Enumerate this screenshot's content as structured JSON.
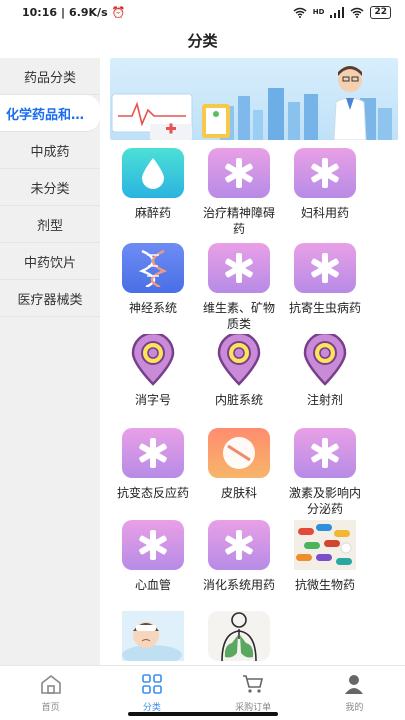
{
  "status": {
    "time": "10:16",
    "speed": "6.9K/s",
    "battery": "22",
    "network": "HD"
  },
  "header": {
    "title": "分类"
  },
  "sidebar": {
    "items": [
      {
        "label": "药品分类"
      },
      {
        "label": "化学药品和…",
        "active": true
      },
      {
        "label": "中成药"
      },
      {
        "label": "未分类"
      },
      {
        "label": "剂型"
      },
      {
        "label": "中药饮片"
      },
      {
        "label": "医疗器械类"
      }
    ]
  },
  "categories": [
    {
      "label": "麻醉药",
      "icon": "drop-icon",
      "style": "cyan"
    },
    {
      "label": "治疗精神障碍药",
      "icon": "asterisk-icon",
      "style": "pink"
    },
    {
      "label": "妇科用药",
      "icon": "asterisk-icon",
      "style": "pink"
    },
    {
      "label": "神经系统",
      "icon": "dna-icon",
      "style": "blue"
    },
    {
      "label": "维生素、矿物质类",
      "icon": "asterisk-icon",
      "style": "pink"
    },
    {
      "label": "抗寄生虫病药",
      "icon": "asterisk-icon",
      "style": "pink"
    },
    {
      "label": "消字号",
      "icon": "pin-icon",
      "style": "pin"
    },
    {
      "label": "内脏系统",
      "icon": "pin-icon",
      "style": "pin"
    },
    {
      "label": "注射剂",
      "icon": "pin-icon",
      "style": "pin"
    },
    {
      "label": "抗变态反应药",
      "icon": "asterisk-icon",
      "style": "pink"
    },
    {
      "label": "皮肤科",
      "icon": "pill-icon",
      "style": "orange"
    },
    {
      "label": "激素及影响内分泌药",
      "icon": "asterisk-icon",
      "style": "pink"
    },
    {
      "label": "心血管",
      "icon": "asterisk-icon",
      "style": "pink"
    },
    {
      "label": "消化系统用药",
      "icon": "asterisk-icon",
      "style": "pink"
    },
    {
      "label": "抗微生物药",
      "icon": "capsules-photo-icon",
      "style": "photo"
    },
    {
      "label": "",
      "icon": "sick-child-photo-icon",
      "style": "photo"
    },
    {
      "label": "",
      "icon": "lungs-icon",
      "style": "photo"
    }
  ],
  "tabbar": {
    "items": [
      {
        "label": "首页",
        "icon": "home-icon"
      },
      {
        "label": "分类",
        "icon": "grid-icon",
        "active": true
      },
      {
        "label": "采购订单",
        "icon": "cart-icon"
      },
      {
        "label": "我的",
        "icon": "person-icon"
      }
    ]
  },
  "colors": {
    "accent": "#1a6cf0",
    "tab_active": "#3a8ef0",
    "sidebar_bg": "#f0f0f0"
  }
}
